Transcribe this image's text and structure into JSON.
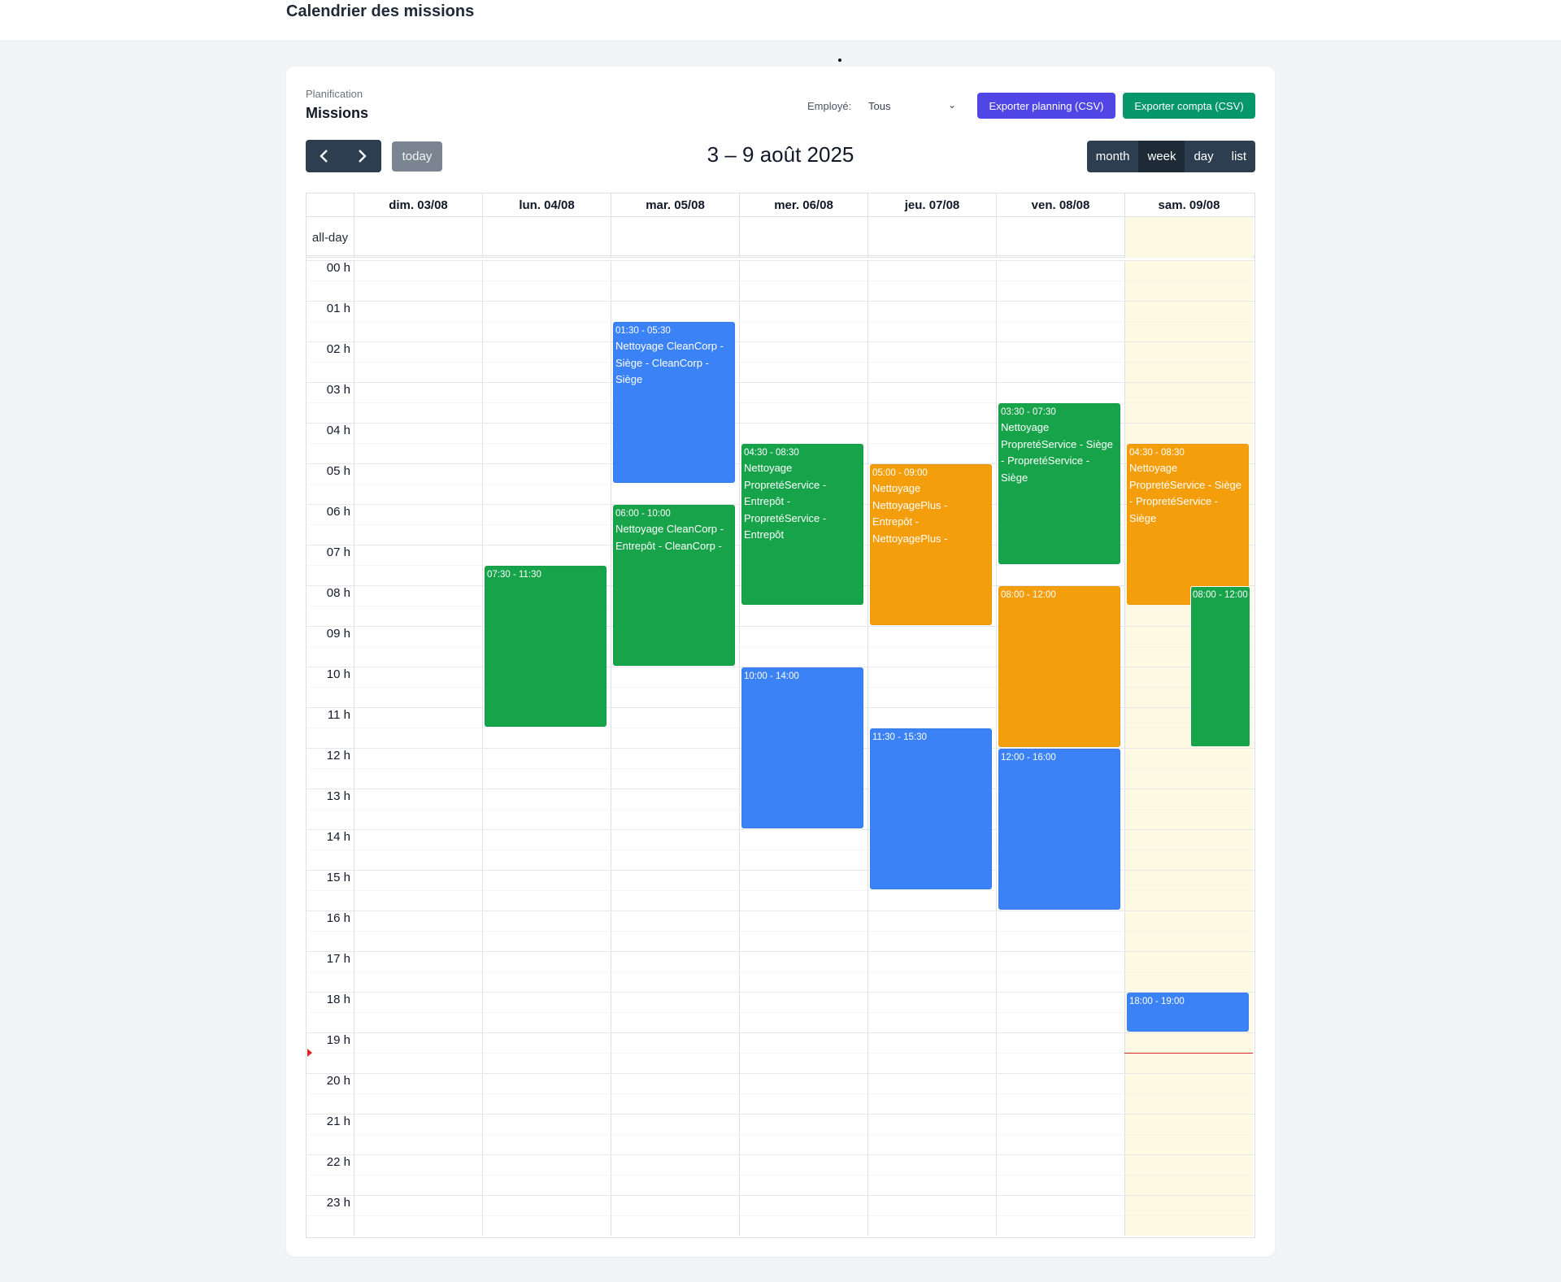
{
  "page": {
    "title": "Calendrier des missions"
  },
  "card": {
    "eyebrow": "Planification",
    "title": "Missions",
    "employee_label": "Employé:",
    "employee_value": "Tous",
    "export_planning": "Exporter planning (CSV)",
    "export_compta": "Exporter compta (CSV)"
  },
  "toolbar": {
    "prev_icon": "‹",
    "next_icon": "›",
    "today": "today",
    "title": "3 – 9 août 2025",
    "views": [
      "month",
      "week",
      "day",
      "list"
    ],
    "active_view": "week"
  },
  "calendar": {
    "allday_label": "all-day",
    "days": [
      "dim. 03/08",
      "lun. 04/08",
      "mar. 05/08",
      "mer. 06/08",
      "jeu. 07/08",
      "ven. 08/08",
      "sam. 09/08"
    ],
    "today_index": 6,
    "hours": [
      "00 h",
      "01 h",
      "02 h",
      "03 h",
      "04 h",
      "05 h",
      "06 h",
      "07 h",
      "08 h",
      "09 h",
      "10 h",
      "11 h",
      "12 h",
      "13 h",
      "14 h",
      "15 h",
      "16 h",
      "17 h",
      "18 h",
      "19 h",
      "20 h",
      "21 h",
      "22 h",
      "23 h"
    ],
    "now_time": "19:30",
    "events": [
      {
        "day": 1,
        "start": "07:30",
        "end": "11:30",
        "time": "07:30 - 11:30",
        "title": "",
        "color": "green"
      },
      {
        "day": 2,
        "start": "01:30",
        "end": "05:30",
        "time": "01:30 - 05:30",
        "title": "Nettoyage CleanCorp - Siège - CleanCorp - Siège",
        "color": "blue"
      },
      {
        "day": 2,
        "start": "06:00",
        "end": "10:00",
        "time": "06:00 - 10:00",
        "title": "Nettoyage CleanCorp - Entrepôt - CleanCorp -",
        "color": "green"
      },
      {
        "day": 3,
        "start": "04:30",
        "end": "08:30",
        "time": "04:30 - 08:30",
        "title": "Nettoyage PropretéService - Entrepôt - PropretéService - Entrepôt",
        "color": "green"
      },
      {
        "day": 3,
        "start": "10:00",
        "end": "14:00",
        "time": "10:00 - 14:00",
        "title": "",
        "color": "blue"
      },
      {
        "day": 4,
        "start": "05:00",
        "end": "09:00",
        "time": "05:00 - 09:00",
        "title": "Nettoyage NettoyagePlus - Entrepôt - NettoyagePlus -",
        "color": "orange"
      },
      {
        "day": 4,
        "start": "11:30",
        "end": "15:30",
        "time": "11:30 - 15:30",
        "title": "",
        "color": "blue"
      },
      {
        "day": 5,
        "start": "03:30",
        "end": "07:30",
        "time": "03:30 - 07:30",
        "title": "Nettoyage PropretéService - Siège - PropretéService - Siège",
        "color": "green"
      },
      {
        "day": 5,
        "start": "08:00",
        "end": "12:00",
        "time": "08:00 - 12:00",
        "title": "",
        "color": "orange"
      },
      {
        "day": 5,
        "start": "12:00",
        "end": "16:00",
        "time": "12:00 - 16:00",
        "title": "",
        "color": "blue"
      },
      {
        "day": 6,
        "start": "04:30",
        "end": "08:30",
        "time": "04:30 - 08:30",
        "title": "Nettoyage PropretéService - Siège - PropretéService - Siège",
        "color": "orange"
      },
      {
        "day": 6,
        "start": "08:00",
        "end": "12:00",
        "time": "08:00 - 12:00",
        "title": "",
        "color": "green",
        "overlap": true
      },
      {
        "day": 6,
        "start": "18:00",
        "end": "19:00",
        "time": "18:00 - 19:00",
        "title": "",
        "color": "blue"
      }
    ]
  }
}
